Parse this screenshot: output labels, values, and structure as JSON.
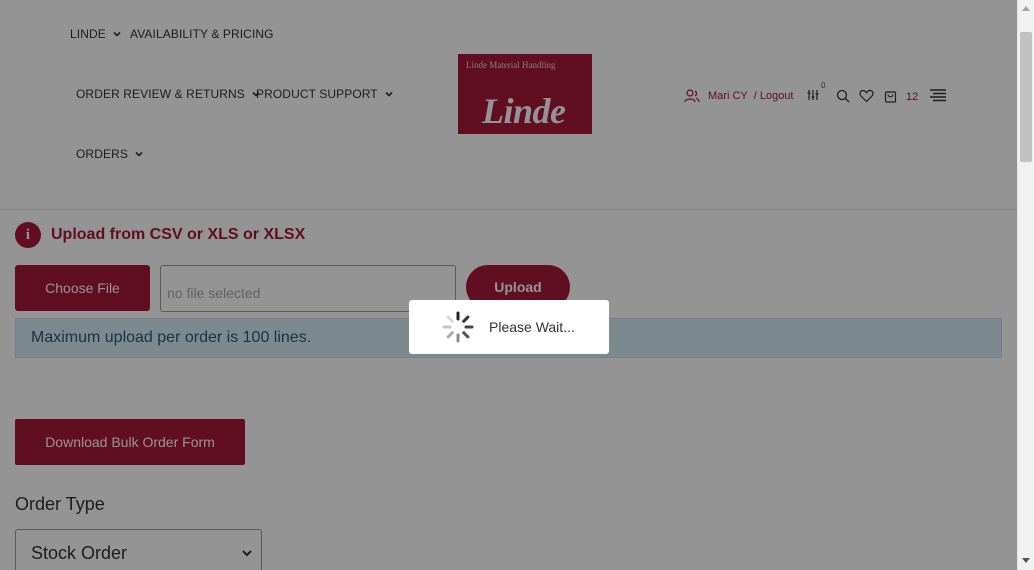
{
  "nav": {
    "linde": "LINDE",
    "availability": "AVAILABILITY & PRICING",
    "order_review": "ORDER REVIEW & RETURNS",
    "product_support": "PRODUCT SUPPORT",
    "orders": "ORDERS"
  },
  "logo": {
    "tagline": "Linde Material Handling",
    "brand": "Linde"
  },
  "user": {
    "name": "Mari CY",
    "logout": "/ Logout",
    "compare_count": "0",
    "cart_count": "12"
  },
  "upload": {
    "title": "Upload from CSV or XLS or XLSX",
    "info_glyph": "i",
    "choose_label": "Choose File",
    "file_placeholder": "no file selected",
    "upload_label": "Upload",
    "notice": "Maximum upload per order is 100 lines."
  },
  "download": {
    "label": "Download Bulk Order Form"
  },
  "order_type": {
    "label": "Order Type",
    "selected": "Stock Order"
  },
  "modal": {
    "text": "Please Wait..."
  },
  "colors": {
    "brand": "#a8193c",
    "notice_bg": "#d6eef6"
  }
}
